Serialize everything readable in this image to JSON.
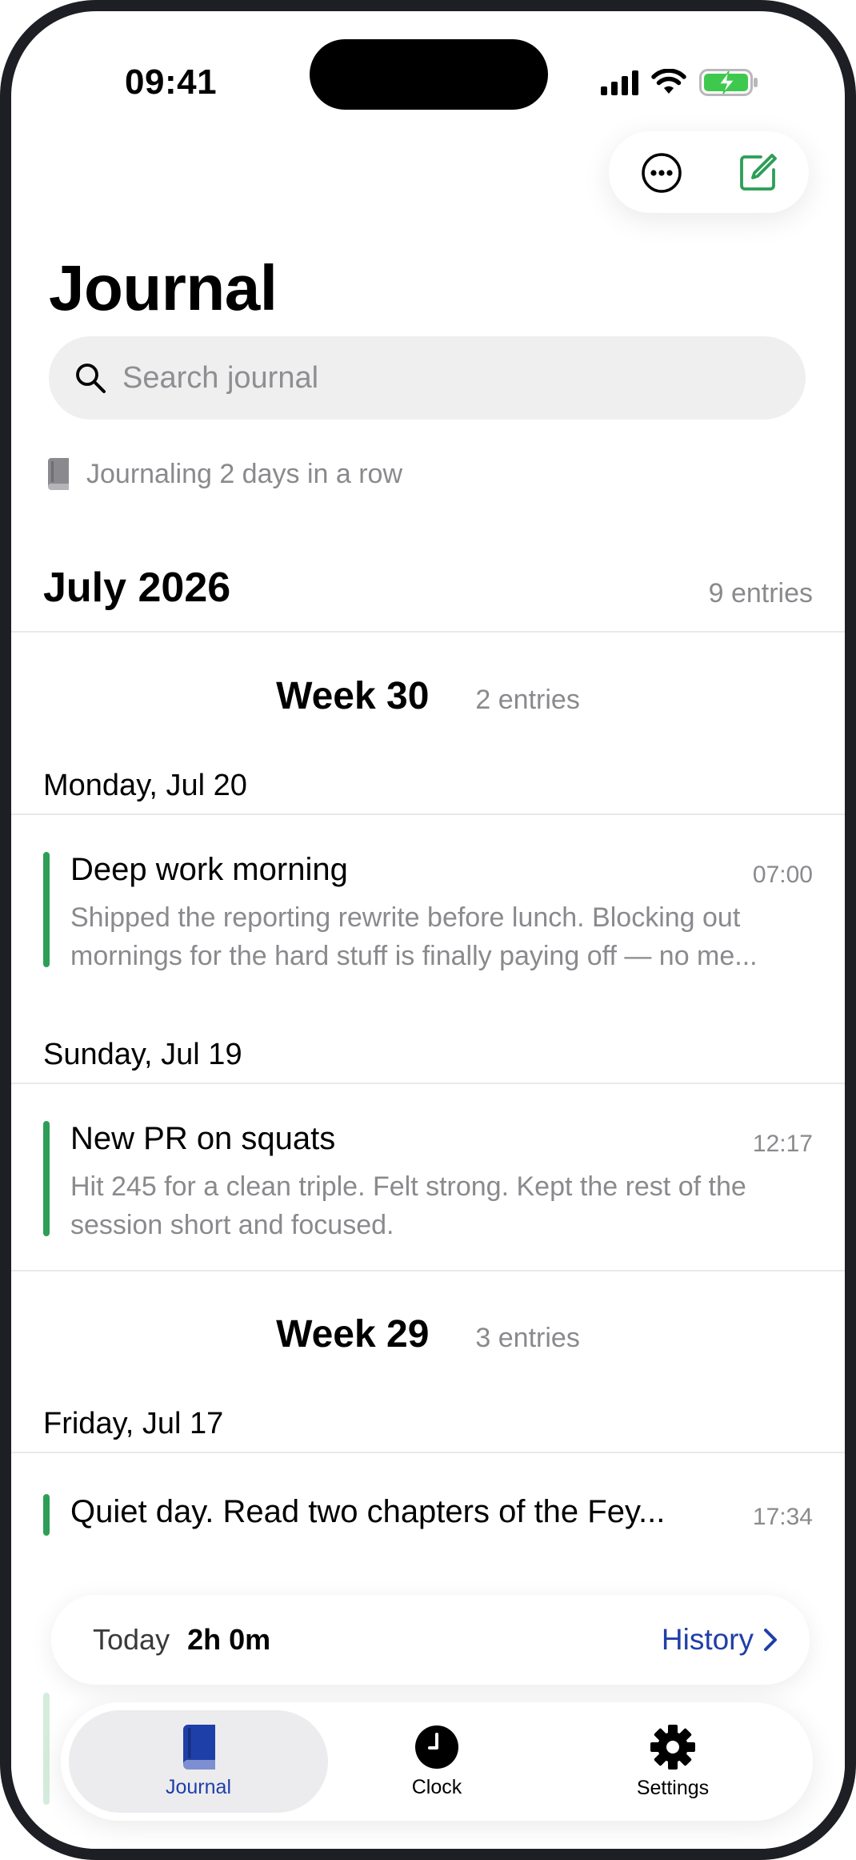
{
  "status": {
    "time": "09:41"
  },
  "header": {
    "title": "Journal"
  },
  "search": {
    "placeholder": "Search journal"
  },
  "streak": {
    "text": "Journaling 2 days in a row"
  },
  "month": {
    "title": "July 2026",
    "count": "9 entries"
  },
  "weeks": [
    {
      "title": "Week 30",
      "count": "2 entries"
    },
    {
      "title": "Week 29",
      "count": "3 entries"
    }
  ],
  "days": [
    {
      "label": "Monday, Jul 20"
    },
    {
      "label": "Sunday, Jul 19"
    },
    {
      "label": "Friday, Jul 17"
    }
  ],
  "entries": [
    {
      "title": "Deep work morning",
      "time": "07:00",
      "body": "Shipped the reporting rewrite before lunch. Blocking out mornings for the hard stuff is finally paying off — no me..."
    },
    {
      "title": "New PR on squats",
      "time": "12:17",
      "body": "Hit 245 for a clean triple. Felt strong. Kept the rest of the session short and focused."
    },
    {
      "title": "Quiet day. Read two chapters of the Fey...",
      "time": "17:34"
    }
  ],
  "today_bar": {
    "label": "Today",
    "value": "2h 0m",
    "history": "History"
  },
  "tabs": [
    {
      "label": "Journal"
    },
    {
      "label": "Clock"
    },
    {
      "label": "Settings"
    }
  ],
  "colors": {
    "accent_green": "#2e9e57",
    "tab_active": "#1f3fa8",
    "battery_green": "#3ec94e"
  }
}
